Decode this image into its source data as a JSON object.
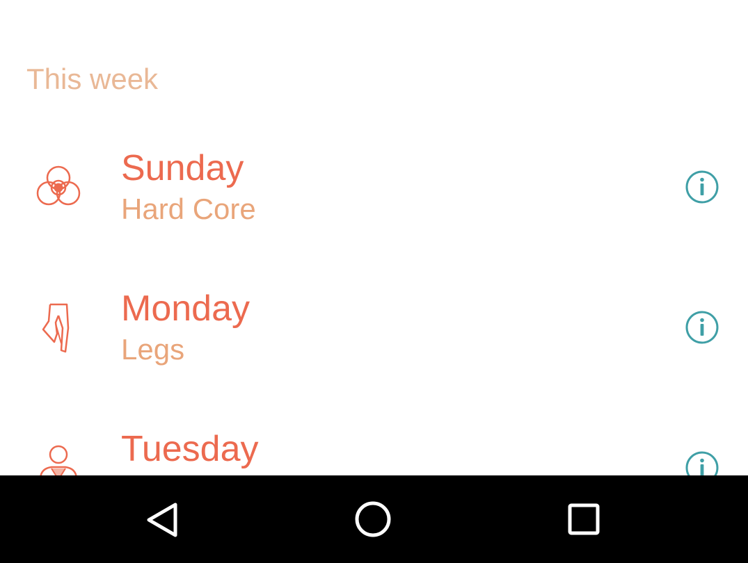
{
  "section": {
    "title": "This week"
  },
  "days": [
    {
      "day": "Sunday",
      "workout": "Hard Core",
      "icon": "core-icon"
    },
    {
      "day": "Monday",
      "workout": "Legs",
      "icon": "legs-icon"
    },
    {
      "day": "Tuesday",
      "workout": "",
      "icon": "upper-body-icon"
    }
  ],
  "colors": {
    "header": "#e9b896",
    "day": "#ec6a4f",
    "workout": "#e9a57a",
    "info": "#3f9fa6",
    "navbar": "#000000"
  },
  "navbar": {
    "buttons": [
      "back-icon",
      "home-icon",
      "recents-icon"
    ]
  }
}
